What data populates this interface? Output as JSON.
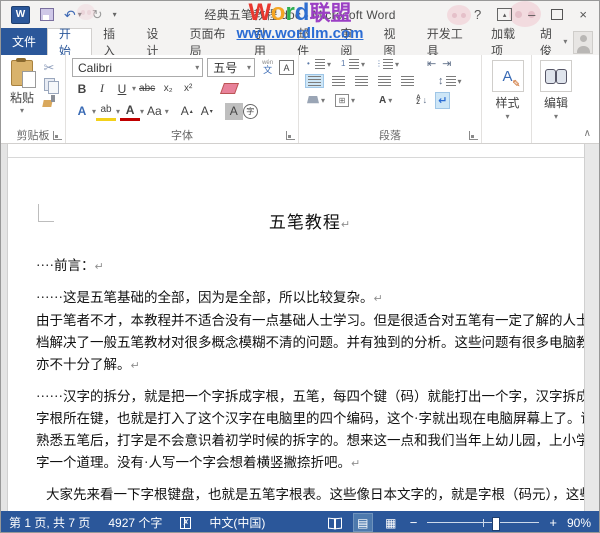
{
  "window": {
    "title": "经典五笔教程.doc - Microsoft Word",
    "help": "?",
    "minimize": "–",
    "close": "×"
  },
  "qat": {
    "logo": "W",
    "undo": "↶",
    "redo": "↻",
    "more": "▾"
  },
  "watermark": {
    "letters": [
      "W",
      "o",
      "r",
      "d",
      "联",
      "盟"
    ],
    "letter_colors": [
      "#e8382f",
      "#f5a623",
      "#2faf4e",
      "#2f6fd0",
      "#9b3fc4",
      "#9b3fc4"
    ],
    "site": "www.wordlm.com",
    "site_color": "#2b6cd4"
  },
  "tabs": {
    "file": "文件",
    "items": [
      "开始",
      "插入",
      "设计",
      "页面布局",
      "引用",
      "邮件",
      "审阅",
      "视图",
      "开发工具",
      "加载项"
    ],
    "user": "胡俊"
  },
  "ribbon": {
    "clipboard": {
      "label": "剪贴板",
      "paste": "粘贴",
      "cut_icon": "✂"
    },
    "font": {
      "label": "字体",
      "name": "Calibri",
      "size": "五号",
      "bold": "B",
      "italic": "I",
      "underline": "U",
      "strike": "abc",
      "subscript": "x₂",
      "superscript": "x²",
      "effects": "A",
      "highlight": "ab",
      "color": "A",
      "case": "Aa",
      "grow": "A",
      "shrink": "A",
      "shade": "A",
      "enclose": "字",
      "phonetic_top": "wén",
      "phonetic_bottom": "文",
      "charborder": "A"
    },
    "paragraph": {
      "label": "段落",
      "indent_dec": "⇤",
      "indent_inc": "⇥",
      "spacing": "↕",
      "sort_a": "A",
      "sort_z": "Z",
      "sort_arrow": "↓",
      "marks": "↵",
      "borders": "⊞"
    },
    "styles": {
      "label": "样式",
      "icon": "A",
      "pen": "✎"
    },
    "editing": {
      "label": "编辑"
    },
    "collapse": "∧"
  },
  "doc": {
    "title": "五笔教程",
    "pilcrow": "↵",
    "lines": [
      "····前言：",
      "······这是五笔基础的全部，因为是全部，所以比较复杂。",
      "由于笔者不才，本教程并不适合没有一点基础人士学习。但是很适合对五笔有一定了解的人士使用。本文",
      "档解决了一般五笔教材对很多概念模糊不清的问题。并有独到的分析。这些问题有很多电脑教学专业人士",
      "亦不十分了解。",
      "······汉字的拆分，就是把一个字拆成字根，五笔，每四个键（码）就能打出一个字，汉字拆成字根后，敲击",
      "字根所在键，也就是打入了这个汉字在电脑里的四个编码，这个·字就出现在电脑屏幕上了。请注意，当你",
      "熟悉五笔后，打字是不会意识着初学时候的拆字的。想来这一点和我们当年上幼儿园，上小学的时候学写",
      "字一个道理。没有·人写一个字会想着横竖撇捺折吧。",
      "大家先来看一下字根键盘，也就是五笔字根表。这些像日本文字的，就是字根（码元），这些字根，像"
    ]
  },
  "statusbar": {
    "page": "第 1 页, 共 7 页",
    "words": "4927 个字",
    "proof_x": "✗",
    "lang": "中文(中国)",
    "zoom_minus": "−",
    "zoom_plus": "+",
    "zoom": "90%"
  }
}
